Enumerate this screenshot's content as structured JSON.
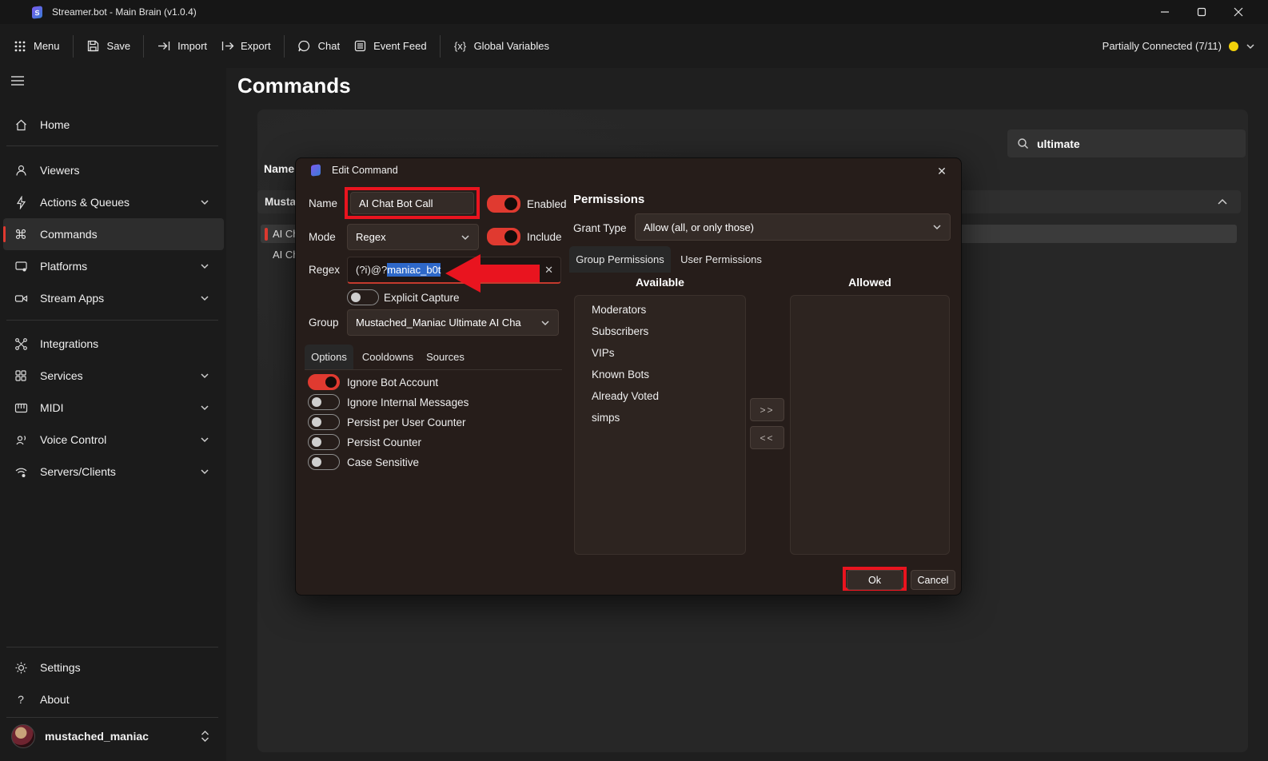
{
  "window": {
    "title": "Streamer.bot - Main Brain (v1.0.4)"
  },
  "toolbar": {
    "menu": "Menu",
    "save": "Save",
    "import": "Import",
    "export": "Export",
    "chat": "Chat",
    "event_feed": "Event Feed",
    "global_variables": "Global Variables",
    "global_variables_glyph": "{x}",
    "status": "Partially Connected (7/11)"
  },
  "sidebar": {
    "items": [
      {
        "label": "Home"
      },
      {
        "label": "Viewers"
      },
      {
        "label": "Actions & Queues"
      },
      {
        "label": "Commands"
      },
      {
        "label": "Platforms"
      },
      {
        "label": "Stream Apps"
      },
      {
        "label": "Integrations"
      },
      {
        "label": "Services"
      },
      {
        "label": "MIDI"
      },
      {
        "label": "Voice Control"
      },
      {
        "label": "Servers/Clients"
      }
    ],
    "settings": "Settings",
    "about": "About",
    "user": "mustached_maniac"
  },
  "main": {
    "title": "Commands",
    "search_value": "ultimate",
    "table": {
      "name_header": "Name",
      "group_row": "Musta",
      "row1": "AI Ch",
      "row2": "AI Ch"
    }
  },
  "dialog": {
    "title": "Edit Command",
    "name_label": "Name",
    "name_value": "AI Chat Bot Call",
    "enabled_label": "Enabled",
    "mode_label": "Mode",
    "mode_value": "Regex",
    "include_label": "Include",
    "regex_label": "Regex",
    "regex_prefix": "(?i)@?",
    "regex_selection": "maniac_b0t",
    "explicit_capture_label": "Explicit Capture",
    "group_label": "Group",
    "group_value": "Mustached_Maniac Ultimate AI Cha",
    "tabs": {
      "options": "Options",
      "cooldowns": "Cooldowns",
      "sources": "Sources"
    },
    "options": [
      {
        "label": "Ignore Bot Account",
        "on": true
      },
      {
        "label": "Ignore Internal Messages",
        "on": false
      },
      {
        "label": "Persist per User Counter",
        "on": false
      },
      {
        "label": "Persist Counter",
        "on": false
      },
      {
        "label": "Case Sensitive",
        "on": false
      }
    ],
    "permissions": {
      "title": "Permissions",
      "grant_type_label": "Grant Type",
      "grant_type_value": "Allow (all, or only those)",
      "tab_group": "Group Permissions",
      "tab_user": "User Permissions",
      "available_header": "Available",
      "allowed_header": "Allowed",
      "available": [
        "Moderators",
        "Subscribers",
        "VIPs",
        "Known Bots",
        "Already Voted",
        "simps"
      ],
      "move_right": ">>",
      "move_left": "<<"
    },
    "ok": "Ok",
    "cancel": "Cancel"
  },
  "colors": {
    "accent_red": "#e03a30",
    "annotation_red": "#e9141f",
    "selection_blue": "#2e68c9",
    "status_yellow": "#f2d10a"
  }
}
